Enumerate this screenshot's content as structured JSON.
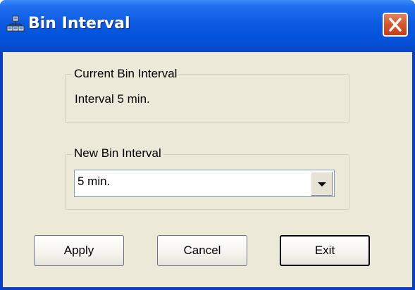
{
  "window": {
    "title": "Bin Interval",
    "title_icon": "network-icon",
    "close_icon": "close-icon"
  },
  "current_group": {
    "label": "Current Bin Interval",
    "value": "Interval 5 min."
  },
  "new_group": {
    "label": "New Bin Interval",
    "selected": "5 min.",
    "dropdown_icon": "chevron-down-icon"
  },
  "buttons": {
    "apply": "Apply",
    "cancel": "Cancel",
    "exit": "Exit"
  },
  "colors": {
    "titlebar": "#0550d8",
    "dialog_face": "#ece9d8",
    "close_button": "#d6552f"
  }
}
